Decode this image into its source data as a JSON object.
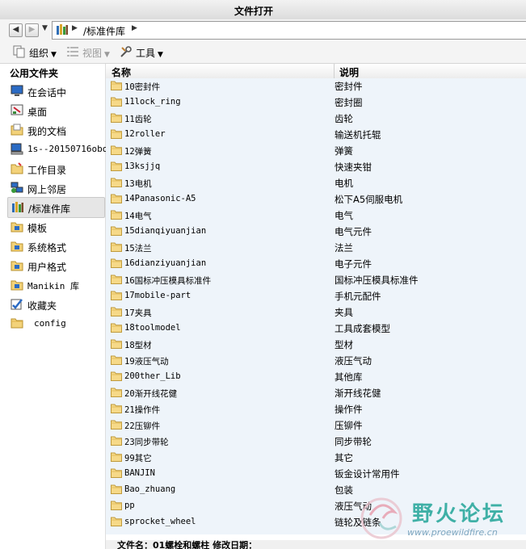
{
  "window": {
    "title": "文件打开"
  },
  "addressbar": {
    "back_label": "◀",
    "forward_label": "▶",
    "path": "/标准件库"
  },
  "toolbar": {
    "organize": "组织",
    "view": "视图",
    "tools": "工具"
  },
  "sidebar": {
    "heading": "公用文件夹",
    "items": [
      {
        "label": "在会话中",
        "icon": "session-icon"
      },
      {
        "label": "桌面",
        "icon": "desktop-icon"
      },
      {
        "label": "我的文档",
        "icon": "documents-icon"
      },
      {
        "label": "1s--20150716obo",
        "icon": "computer-icon"
      },
      {
        "label": "工作目录",
        "icon": "working-dir-icon"
      },
      {
        "label": "网上邻居",
        "icon": "network-icon"
      },
      {
        "label": "/标准件库",
        "icon": "library-icon"
      },
      {
        "label": "模板",
        "icon": "template-icon"
      },
      {
        "label": "系统格式",
        "icon": "system-format-icon"
      },
      {
        "label": "用户格式",
        "icon": "user-format-icon"
      },
      {
        "label": "Manikin 库",
        "icon": "manikin-icon"
      },
      {
        "label": "收藏夹",
        "icon": "favorites-icon"
      },
      {
        "label": "config",
        "icon": "folder-icon"
      }
    ]
  },
  "filelist": {
    "col_name": "名称",
    "col_desc": "说明",
    "rows": [
      {
        "name": "10密封件",
        "desc": "密封件"
      },
      {
        "name": "11lock_ring",
        "desc": "密封圈"
      },
      {
        "name": "11齿轮",
        "desc": "齿轮"
      },
      {
        "name": "12roller",
        "desc": "输送机托辊"
      },
      {
        "name": "12弹簧",
        "desc": "弹簧"
      },
      {
        "name": "13ksjjq",
        "desc": "快速夹钳"
      },
      {
        "name": "13电机",
        "desc": "电机"
      },
      {
        "name": "14Panasonic-A5",
        "desc": "松下A5伺服电机"
      },
      {
        "name": "14电气",
        "desc": "电气"
      },
      {
        "name": "15dianqiyuanjian",
        "desc": "电气元件"
      },
      {
        "name": "15法兰",
        "desc": "法兰"
      },
      {
        "name": "16dianziyuanjian",
        "desc": "电子元件"
      },
      {
        "name": "16国标冲压模具标准件",
        "desc": "国标冲压模具标准件"
      },
      {
        "name": "17mobile-part",
        "desc": "手机元配件"
      },
      {
        "name": "17夹具",
        "desc": "夹具"
      },
      {
        "name": "18toolmodel",
        "desc": "工具成套模型"
      },
      {
        "name": "18型材",
        "desc": "型材"
      },
      {
        "name": "19液压气动",
        "desc": "液压气动"
      },
      {
        "name": "200ther_Lib",
        "desc": "其他库"
      },
      {
        "name": "20渐开线花健",
        "desc": "渐开线花健"
      },
      {
        "name": "21操作件",
        "desc": "操作件"
      },
      {
        "name": "22压铆件",
        "desc": "压铆件"
      },
      {
        "name": "23同步带轮",
        "desc": "同步带轮"
      },
      {
        "name": "99其它",
        "desc": "其它"
      },
      {
        "name": "BANJIN",
        "desc": "钣金设计常用件"
      },
      {
        "name": "Bao_zhuang",
        "desc": "包装"
      },
      {
        "name": "pp",
        "desc": "液压气动"
      },
      {
        "name": "sprocket_wheel",
        "desc": "链轮及链条"
      }
    ]
  },
  "status": {
    "text": "文件名：01螺栓和螺柱  修改日期："
  },
  "watermark": {
    "brand": "野火论坛",
    "url": "www.proewildfire.cn"
  }
}
